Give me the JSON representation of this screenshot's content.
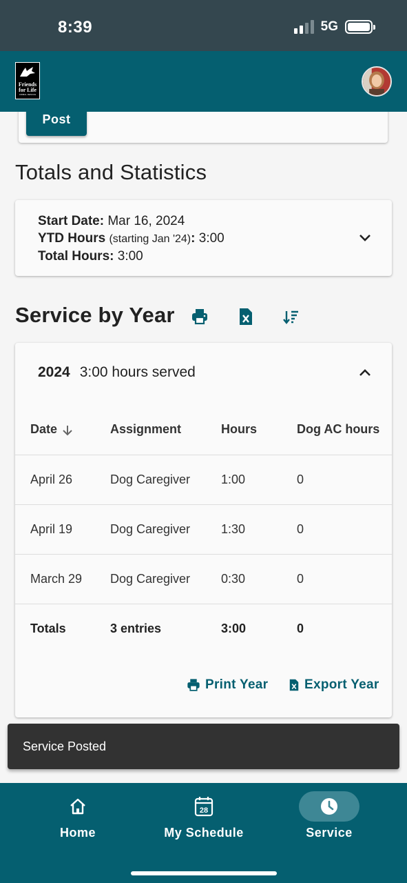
{
  "status_bar": {
    "time": "8:39",
    "network": "5G"
  },
  "header": {
    "logo_line1": "Friends",
    "logo_line2": "for Life",
    "logo_line3": "ANIMAL RESCUE"
  },
  "post_button": {
    "label": "Post"
  },
  "totals": {
    "heading": "Totals and Statistics",
    "start_date_label": "Start Date:",
    "start_date_value": "Mar 16, 2024",
    "ytd_label": "YTD Hours",
    "ytd_note": "(starting Jan '24)",
    "ytd_colon": ":",
    "ytd_value": "3:00",
    "total_label": "Total Hours:",
    "total_value": "3:00"
  },
  "service_by_year": {
    "heading": "Service by Year",
    "year": "2024",
    "year_summary": "3:00 hours served",
    "columns": [
      "Date",
      "Assignment",
      "Hours",
      "Dog AC hours"
    ],
    "rows": [
      {
        "date": "April 26",
        "assignment": "Dog Caregiver",
        "hours": "1:00",
        "dog_ac": "0"
      },
      {
        "date": "April 19",
        "assignment": "Dog Caregiver",
        "hours": "1:30",
        "dog_ac": "0"
      },
      {
        "date": "March 29",
        "assignment": "Dog Caregiver",
        "hours": "0:30",
        "dog_ac": "0"
      }
    ],
    "totals_row": {
      "label": "Totals",
      "entries": "3 entries",
      "hours": "3:00",
      "dog_ac": "0"
    },
    "print_year": "Print Year",
    "export_year": "Export Year"
  },
  "snackbar": {
    "message": "Service Posted"
  },
  "bottom_nav": {
    "items": [
      {
        "label": "Home",
        "icon": "home-icon"
      },
      {
        "label": "My Schedule",
        "icon": "calendar-icon",
        "calendar_day": "28"
      },
      {
        "label": "Service",
        "icon": "clock-icon",
        "active": true
      }
    ]
  },
  "colors": {
    "primary": "#055f70",
    "status_bar": "#34474f",
    "snackbar": "#323232",
    "active_pill": "#3e8795"
  }
}
